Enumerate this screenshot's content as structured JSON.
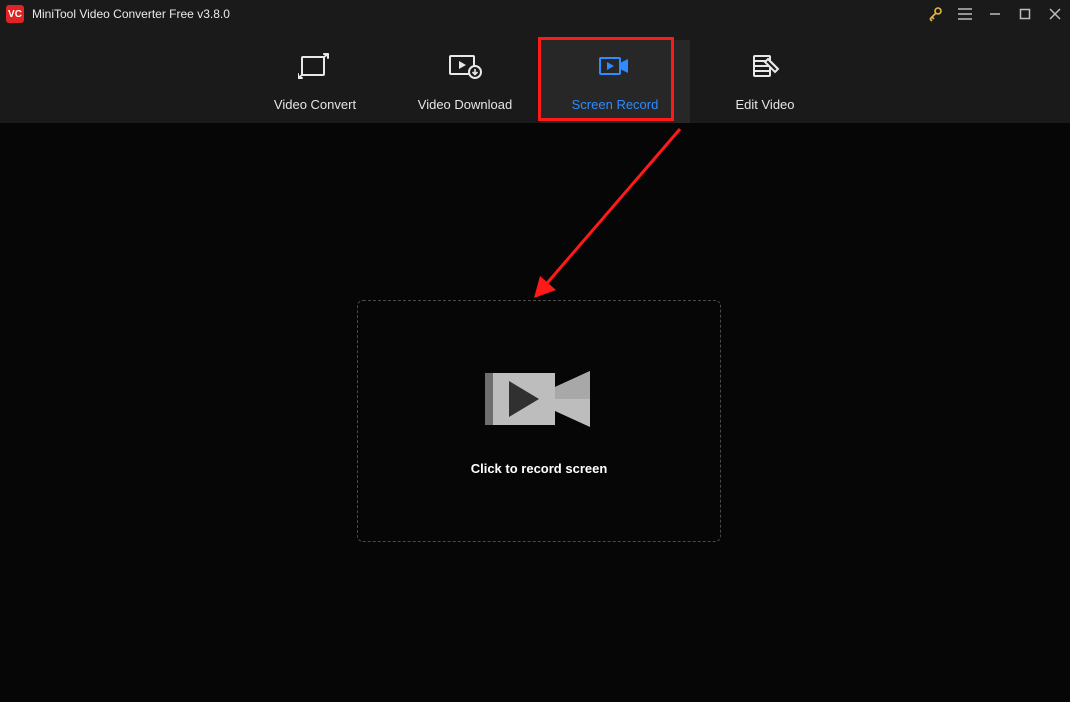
{
  "app": {
    "logo_text": "VC",
    "title": "MiniTool Video Converter Free v3.8.0"
  },
  "tabs": {
    "convert": {
      "label": "Video Convert"
    },
    "download": {
      "label": "Video Download"
    },
    "record": {
      "label": "Screen Record"
    },
    "edit": {
      "label": "Edit Video"
    }
  },
  "screen_record": {
    "placeholder_caption": "Click to record screen"
  }
}
